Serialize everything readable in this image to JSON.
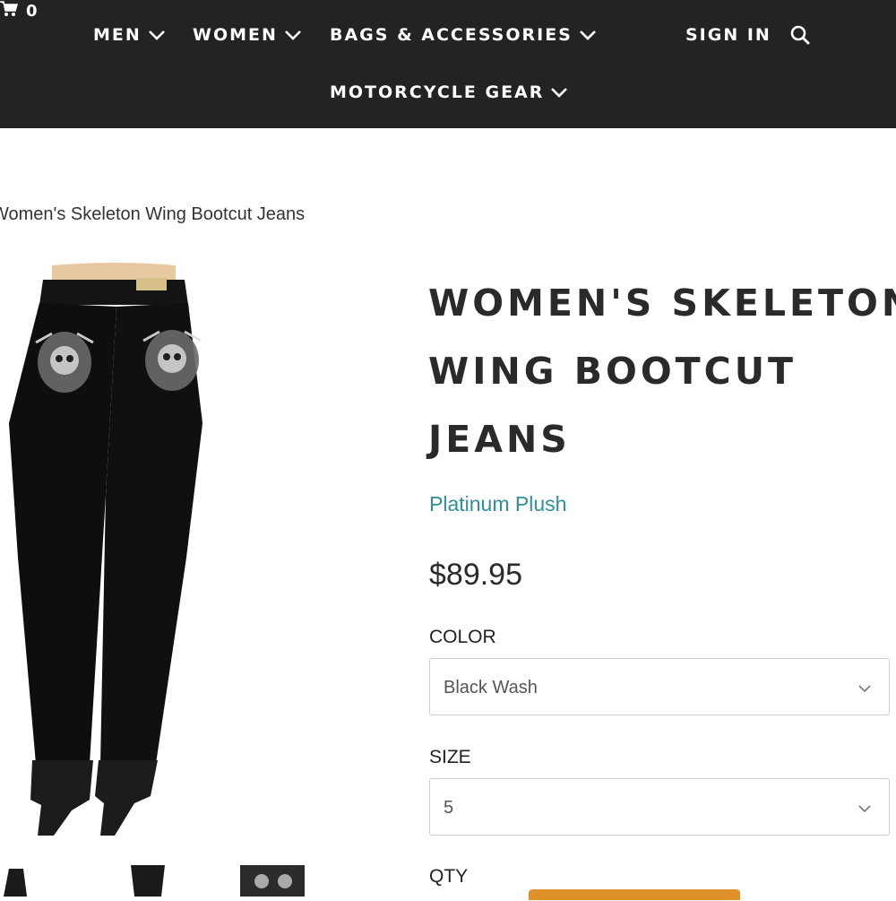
{
  "header": {
    "nav": {
      "men": "MEN",
      "women": "WOMEN",
      "bags": "BAGS & ACCESSORIES",
      "motorcycle_gear": "MOTORCYCLE GEAR"
    },
    "sign_in": "SIGN IN",
    "cart_count": "0",
    "icons": [
      "chevron-down-icon",
      "search-icon",
      "cart-icon"
    ]
  },
  "breadcrumb": "Women's Skeleton Wing Bootcut Jeans",
  "product": {
    "title_lines": [
      "WOMEN'S SKELETON",
      "WING BOOTCUT",
      "JEANS"
    ],
    "vendor": "Platinum Plush",
    "price": "$89.95",
    "color": {
      "label": "COLOR",
      "selected": "Black Wash"
    },
    "size": {
      "label": "SIZE",
      "selected": "5"
    },
    "qty_label": "QTY"
  },
  "colors": {
    "header_bg": "#232323",
    "vendor_link": "#2f8f9b",
    "add_button": "#e0902a"
  }
}
